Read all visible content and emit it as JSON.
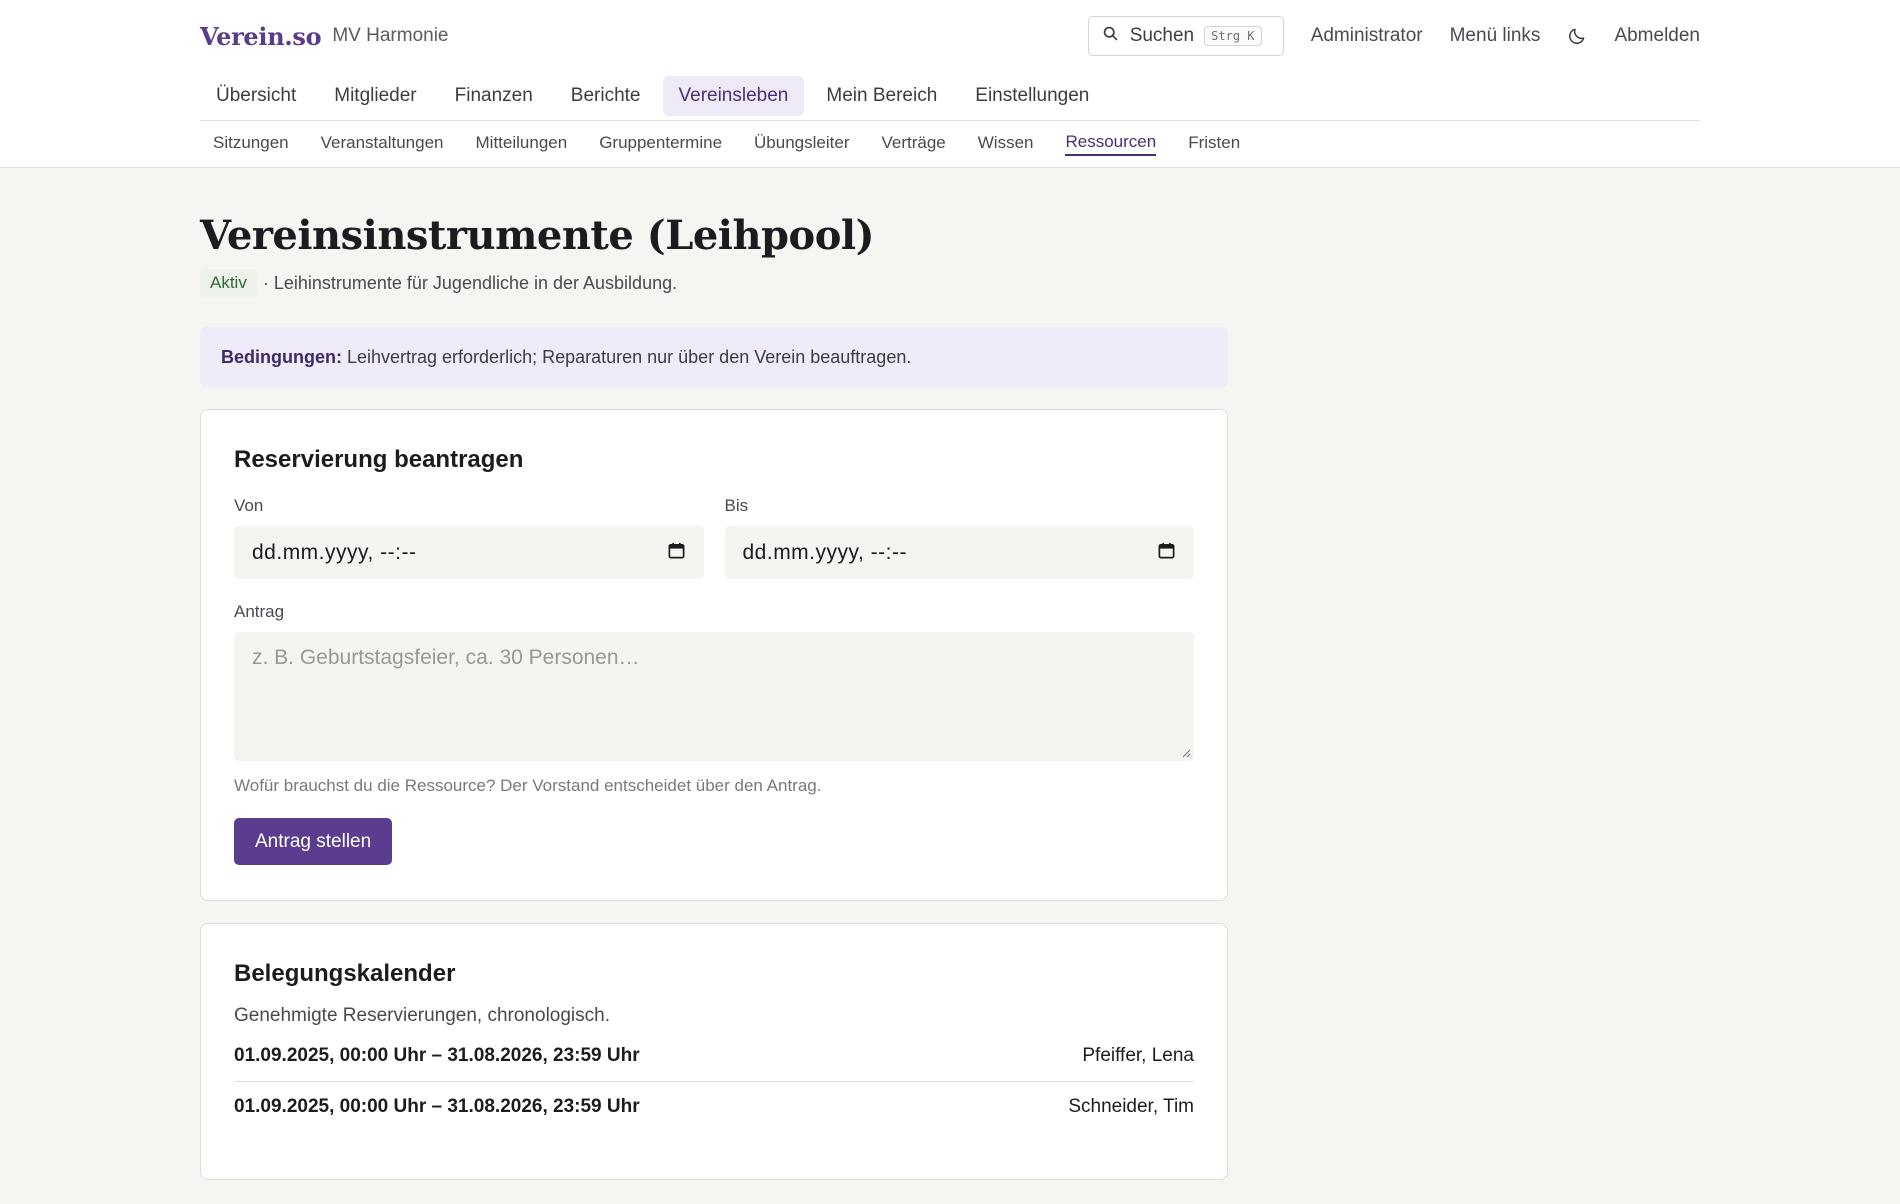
{
  "header": {
    "logo": "Verein.so",
    "club_name": "MV Harmonie",
    "search_label": "Suchen",
    "search_shortcut": "Strg K",
    "admin_label": "Administrator",
    "menu_label": "Menü links",
    "theme_icon": "moon-icon",
    "logout_label": "Abmelden"
  },
  "main_nav": [
    {
      "label": "Übersicht",
      "active": false
    },
    {
      "label": "Mitglieder",
      "active": false
    },
    {
      "label": "Finanzen",
      "active": false
    },
    {
      "label": "Berichte",
      "active": false
    },
    {
      "label": "Vereinsleben",
      "active": true
    },
    {
      "label": "Mein Bereich",
      "active": false
    },
    {
      "label": "Einstellungen",
      "active": false
    }
  ],
  "sub_nav": [
    {
      "label": "Sitzungen",
      "active": false
    },
    {
      "label": "Veranstaltungen",
      "active": false
    },
    {
      "label": "Mitteilungen",
      "active": false
    },
    {
      "label": "Gruppentermine",
      "active": false
    },
    {
      "label": "Übungsleiter",
      "active": false
    },
    {
      "label": "Verträge",
      "active": false
    },
    {
      "label": "Wissen",
      "active": false
    },
    {
      "label": "Ressourcen",
      "active": true
    },
    {
      "label": "Fristen",
      "active": false
    }
  ],
  "page": {
    "title": "Vereinsinstrumente (Leihpool)",
    "status": "Aktiv",
    "description": "· Leihinstrumente für Jugendliche in der Ausbildung.",
    "conditions_label": "Bedingungen:",
    "conditions_text": "Leihvertrag erforderlich; Reparaturen nur über den Verein beauftragen."
  },
  "reservation_form": {
    "title": "Reservierung beantragen",
    "from_label": "Von",
    "from_value": "dd.mm.yyyy, --:--",
    "to_label": "Bis",
    "to_value": "dd.mm.yyyy, --:--",
    "request_label": "Antrag",
    "request_placeholder": "z. B. Geburtstagsfeier, ca. 30 Personen…",
    "hint": "Wofür brauchst du die Ressource? Der Vorstand entscheidet über den Antrag.",
    "submit_label": "Antrag stellen"
  },
  "calendar": {
    "title": "Belegungskalender",
    "subtitle": "Genehmigte Reservierungen, chronologisch.",
    "entries": [
      {
        "dates": "01.09.2025, 00:00 Uhr – 31.08.2026, 23:59 Uhr",
        "name": "Pfeiffer, Lena"
      },
      {
        "dates": "01.09.2025, 00:00 Uhr – 31.08.2026, 23:59 Uhr",
        "name": "Schneider, Tim"
      }
    ]
  },
  "colors": {
    "accent": "#5b3d8f",
    "accent_light": "#efeaf7",
    "status_green": "#2e6b35",
    "background": "#f6f5f1"
  }
}
